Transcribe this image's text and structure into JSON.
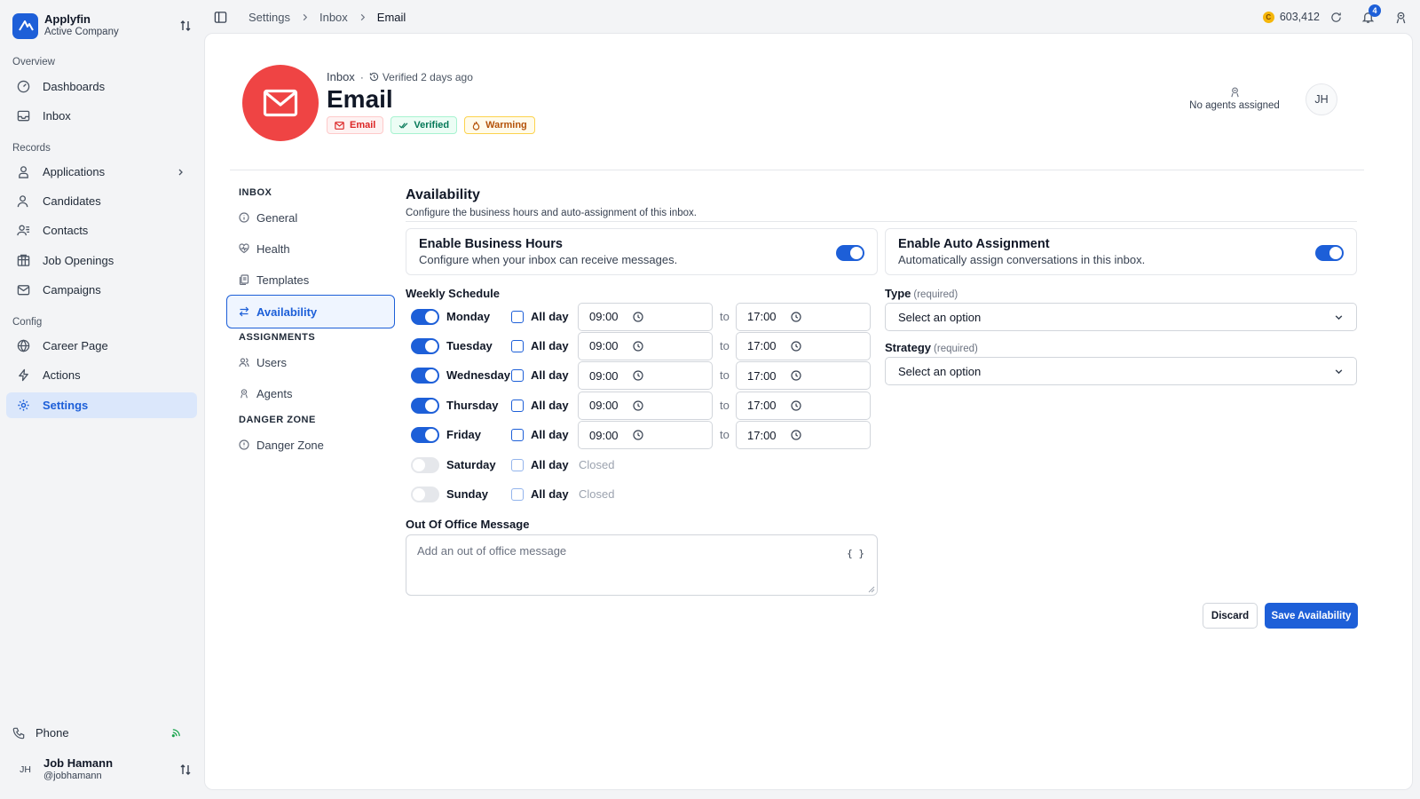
{
  "brand": {
    "name": "Applyfin",
    "company": "Active Company"
  },
  "sidebar": {
    "sections": [
      {
        "label": "Overview",
        "items": [
          {
            "label": "Dashboards",
            "icon": "dashboard-icon"
          },
          {
            "label": "Inbox",
            "icon": "inbox-icon"
          }
        ]
      },
      {
        "label": "Records",
        "items": [
          {
            "label": "Applications",
            "icon": "applications-icon"
          },
          {
            "label": "Candidates",
            "icon": "candidates-icon"
          },
          {
            "label": "Contacts",
            "icon": "contacts-icon"
          },
          {
            "label": "Job Openings",
            "icon": "job-openings-icon"
          },
          {
            "label": "Campaigns",
            "icon": "campaigns-icon"
          }
        ]
      },
      {
        "label": "Config",
        "items": [
          {
            "label": "Career Page",
            "icon": "globe-icon"
          },
          {
            "label": "Actions",
            "icon": "lightning-icon"
          },
          {
            "label": "Settings",
            "icon": "gear-icon",
            "active": true
          }
        ]
      }
    ],
    "phone": "Phone",
    "user": {
      "initials": "JH",
      "name": "Job Hamann",
      "handle": "@jobhamann"
    }
  },
  "topbar": {
    "breadcrumbs": [
      "Settings",
      "Inbox",
      "Email"
    ],
    "credits": "603,412",
    "coin_symbol": "C",
    "notification_count": "4"
  },
  "hero": {
    "context": "Inbox",
    "verified": "Verified 2 days ago",
    "title": "Email",
    "badges": [
      {
        "label": "Email",
        "color": "#dc2626"
      },
      {
        "label": "Verified",
        "color": "#047857"
      },
      {
        "label": "Warming",
        "color": "#b45309"
      }
    ],
    "agents": "No agents assigned",
    "user_initials": "JH",
    "avatar_color": "#ef4444"
  },
  "settings_nav": {
    "inbox_section": "INBOX",
    "inbox_items": [
      "General",
      "Health",
      "Templates",
      "Availability"
    ],
    "assignments_section": "ASSIGNMENTS",
    "assignments_items": [
      "Users",
      "Agents"
    ],
    "danger_section": "DANGER ZONE",
    "danger_items": [
      "Danger Zone"
    ]
  },
  "availability": {
    "title": "Availability",
    "subtitle": "Configure the business hours and auto-assignment of this inbox.",
    "business_hours": {
      "title": "Enable Business Hours",
      "desc": "Configure when your inbox can receive messages.",
      "enabled": true
    },
    "auto_assignment": {
      "title": "Enable Auto Assignment",
      "desc": "Automatically assign conversations in this inbox.",
      "enabled": true
    },
    "weekly_label": "Weekly Schedule",
    "all_day_label": "All day",
    "to_label": "to",
    "closed_label": "Closed",
    "days": [
      {
        "name": "Monday",
        "enabled": true,
        "start": "09:00",
        "end": "17:00"
      },
      {
        "name": "Tuesday",
        "enabled": true,
        "start": "09:00",
        "end": "17:00"
      },
      {
        "name": "Wednesday",
        "enabled": true,
        "start": "09:00",
        "end": "17:00"
      },
      {
        "name": "Thursday",
        "enabled": true,
        "start": "09:00",
        "end": "17:00"
      },
      {
        "name": "Friday",
        "enabled": true,
        "start": "09:00",
        "end": "17:00"
      },
      {
        "name": "Saturday",
        "enabled": false
      },
      {
        "name": "Sunday",
        "enabled": false
      }
    ],
    "type_label": "Type",
    "strategy_label": "Strategy",
    "required": "(required)",
    "select_placeholder": "Select an option",
    "oom_label": "Out Of Office Message",
    "oom_placeholder": "Add an out of office message",
    "braces": "{ }",
    "discard": "Discard",
    "save": "Save Availability"
  },
  "colors": {
    "accent": "#1d5fd8",
    "danger": "#ef4444"
  }
}
